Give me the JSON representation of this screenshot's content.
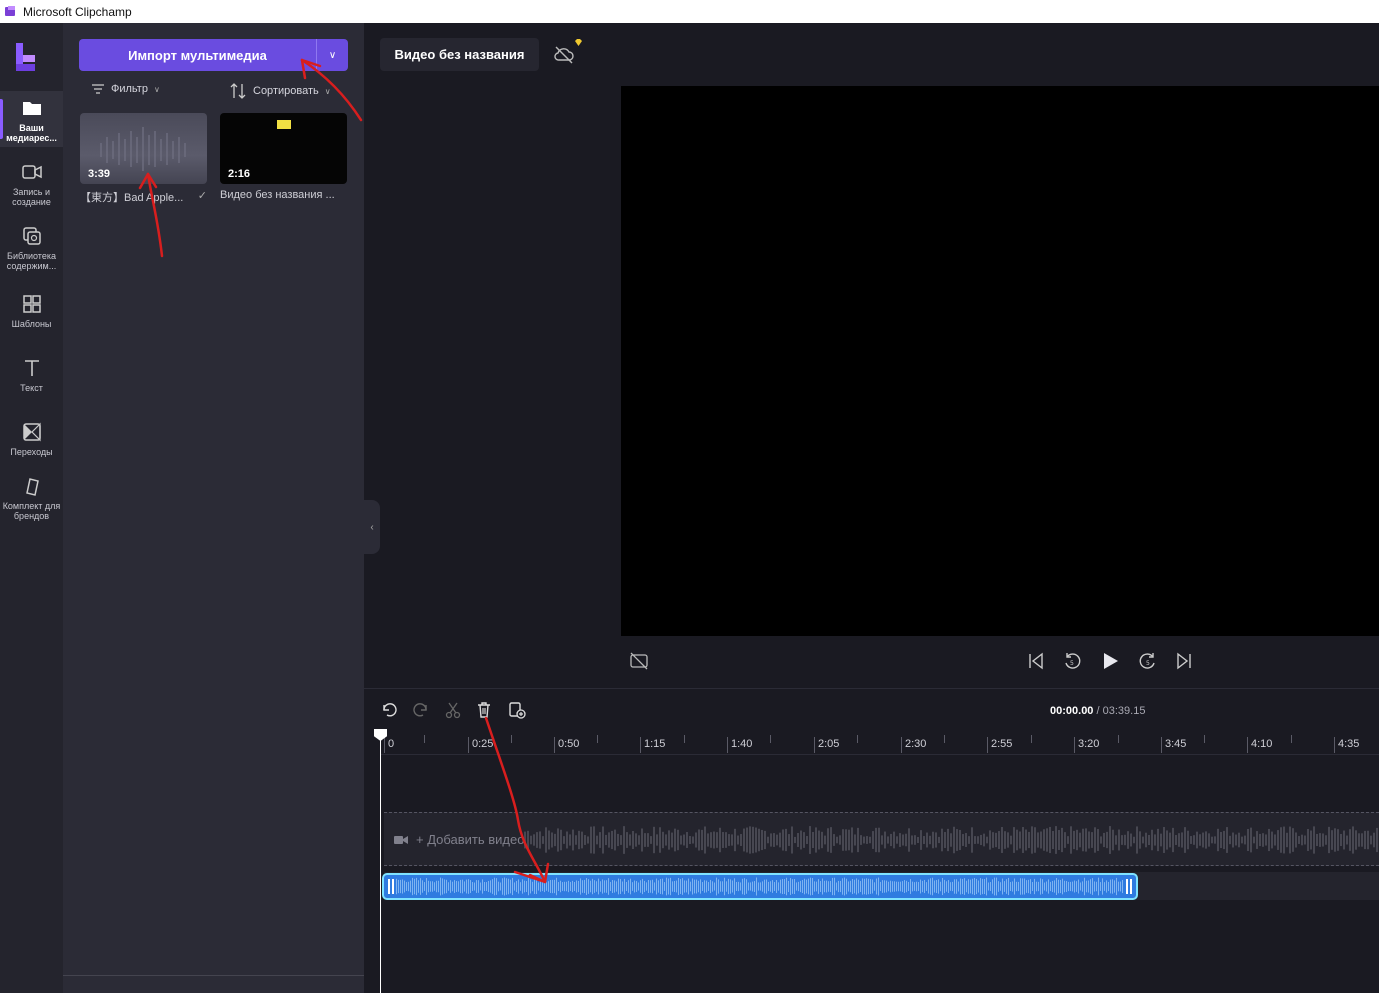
{
  "window": {
    "title": "Microsoft Clipchamp"
  },
  "nav": {
    "items": [
      {
        "label": "Ваши медиарес...",
        "icon": "folder-icon",
        "active": true
      },
      {
        "label": "Запись и создание",
        "icon": "camera-icon"
      },
      {
        "label": "Библиотека содержим...",
        "icon": "library-icon"
      },
      {
        "label": "Шаблоны",
        "icon": "templates-icon"
      },
      {
        "label": "Текст",
        "icon": "text-icon"
      },
      {
        "label": "Переходы",
        "icon": "transitions-icon"
      },
      {
        "label": "Комплект для брендов",
        "icon": "brand-kit-icon"
      }
    ]
  },
  "media_panel": {
    "import_label": "Импорт мультимедиа",
    "filter_label": "Фильтр",
    "sort_label": "Сортировать",
    "items": [
      {
        "duration": "3:39",
        "name": "【東方】Bad Apple...",
        "added": true
      },
      {
        "duration": "2:16",
        "name": "Видео без названия ..."
      }
    ]
  },
  "project": {
    "title": "Видео без названия"
  },
  "timeline": {
    "current_time": "00:00.00",
    "total_time": "/ 03:39.15",
    "ticks": [
      "0",
      "0:25",
      "0:50",
      "1:15",
      "1:40",
      "2:05",
      "2:30",
      "2:55",
      "3:20",
      "3:45",
      "4:10",
      "4:35"
    ],
    "add_video_label": "+ Добавить видео"
  },
  "colors": {
    "accent": "#6a4ce0",
    "audio_clip": "#2f7be0",
    "annotation_arrow": "#d81e1e"
  }
}
